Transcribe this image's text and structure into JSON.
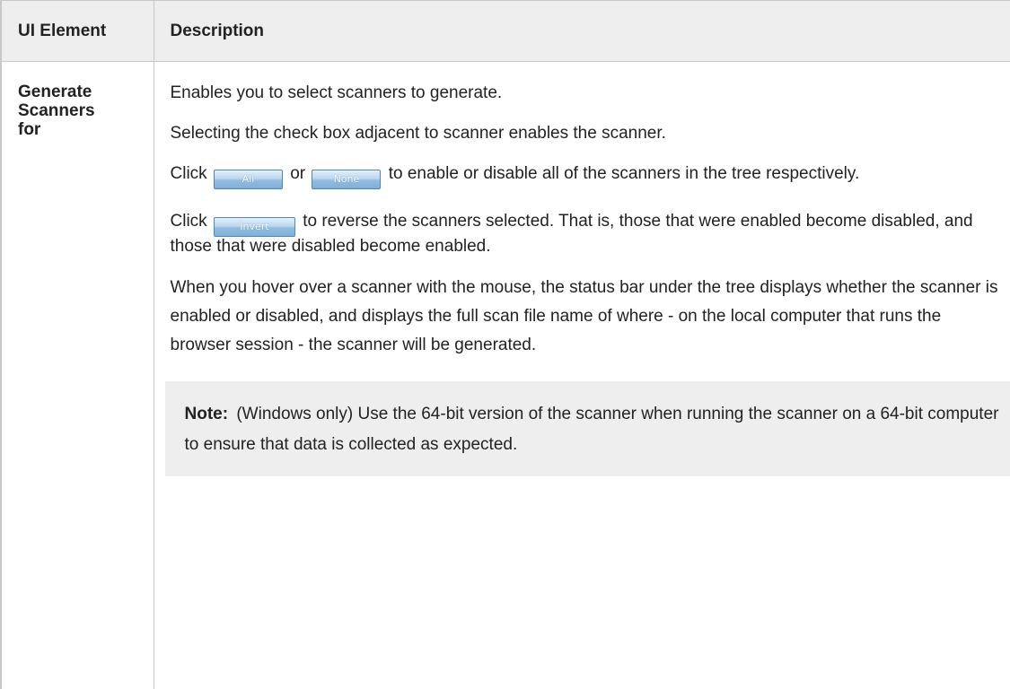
{
  "table": {
    "headers": {
      "element": "UI Element",
      "description": "Description"
    },
    "row": {
      "element_lines": [
        "Generate",
        "Scanners",
        "for"
      ],
      "p1": "Enables you to select scanners to generate.",
      "p2": "Selecting the check box adjacent to scanner enables the scanner.",
      "p3": {
        "prefix": "Click",
        "btn_all": "All",
        "middle": "or",
        "btn_none": "None",
        "suffix": "to enable or disable all of the scanners in the tree respectively."
      },
      "p4": {
        "prefix": "Click",
        "btn_invert": "Invert",
        "suffix": "to reverse the scanners selected. That is, those that were enabled become disabled, and those that were disabled become enabled."
      },
      "p5": "When you hover over a scanner with the mouse, the status bar under the tree displays whether the scanner is enabled or disabled, and displays the full scan file name of where - on the local computer that runs the browser session - the scanner will be generated.",
      "note": {
        "label": "Note:",
        "text": "(Windows only) Use the 64-bit version of the scanner when running the scanner on a 64-bit computer to ensure that data is collected as expected."
      }
    }
  }
}
